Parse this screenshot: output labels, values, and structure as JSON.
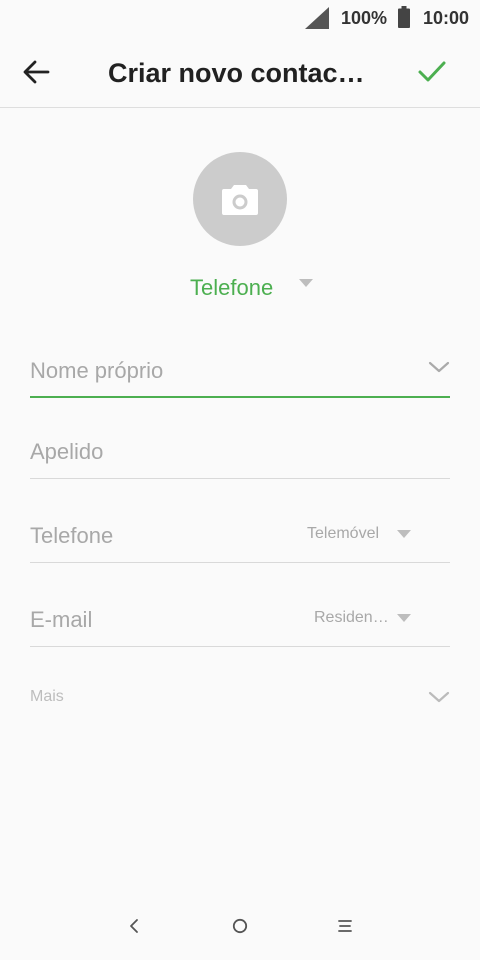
{
  "status_bar": {
    "battery_percent": "100%",
    "time": "10:00",
    "icons": [
      "signal-icon",
      "battery-icon"
    ]
  },
  "app_bar": {
    "title": "Criar novo contac…",
    "icons": [
      "back-arrow-icon",
      "checkmark-icon"
    ]
  },
  "photo": {
    "icon": "camera-icon"
  },
  "account": {
    "label": "Telefone"
  },
  "fields": {
    "first_name": {
      "placeholder": "Nome próprio"
    },
    "last_name": {
      "placeholder": "Apelido"
    },
    "phone": {
      "placeholder": "Telefone",
      "type": "Telemóvel"
    },
    "email": {
      "placeholder": "E-mail",
      "type": "Residen…"
    }
  },
  "more": {
    "label": "Mais"
  },
  "nav_bar": {
    "icons": [
      "back-nav-icon",
      "home-nav-icon",
      "menu-nav-icon"
    ]
  },
  "colors": {
    "accent": "#4caf50",
    "hint": "#a8a8a8",
    "divider": "#d9d9d9",
    "avatar": "#cccccc"
  }
}
